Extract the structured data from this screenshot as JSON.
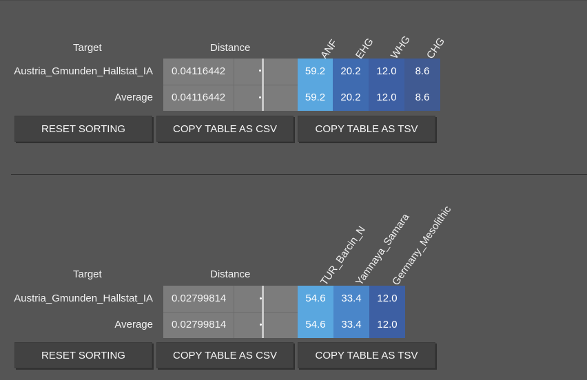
{
  "table1": {
    "headers": {
      "target": "Target",
      "distance": "Distance"
    },
    "columns": [
      "ANF",
      "EHG",
      "WHG",
      "CHG"
    ],
    "rows": [
      {
        "name": "Austria_Gmunden_Hallstat_IA",
        "distance": "0.04116442",
        "values": [
          "59.2",
          "20.2",
          "12.0",
          "8.6"
        ]
      },
      {
        "name": "Average",
        "distance": "0.04116442",
        "values": [
          "59.2",
          "20.2",
          "12.0",
          "8.6"
        ]
      }
    ],
    "column_colors": [
      "#5aa7df",
      "#3f6bb0",
      "#3d5fa3",
      "#405a92"
    ],
    "buttons": {
      "reset": "RESET SORTING",
      "copy_csv": "COPY TABLE AS CSV",
      "copy_tsv": "COPY TABLE AS TSV"
    }
  },
  "table2": {
    "headers": {
      "target": "Target",
      "distance": "Distance"
    },
    "columns": [
      "TUR_Barcin_N",
      "Yamnaya_Samara",
      "Germany_Mesolithic"
    ],
    "rows": [
      {
        "name": "Austria_Gmunden_Hallstat_IA",
        "distance": "0.02799814",
        "values": [
          "54.6",
          "33.4",
          "12.0"
        ]
      },
      {
        "name": "Average",
        "distance": "0.02799814",
        "values": [
          "54.6",
          "33.4",
          "12.0"
        ]
      }
    ],
    "column_colors": [
      "#5aa7df",
      "#4a86c9",
      "#3d5fa3"
    ],
    "buttons": {
      "reset": "RESET SORTING",
      "copy_csv": "COPY TABLE AS CSV",
      "copy_tsv": "COPY TABLE AS TSV"
    }
  }
}
